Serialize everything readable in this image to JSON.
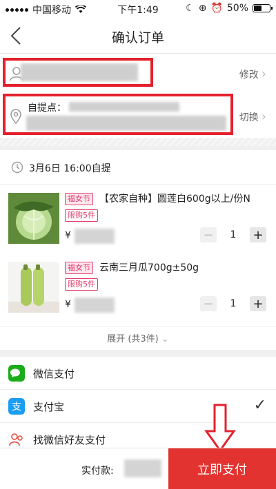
{
  "status_bar": {
    "carrier": "中国移动",
    "time": "下午1:49",
    "battery": "50%",
    "battery_level": 0.5
  },
  "nav": {
    "title": "确认订单",
    "back_icon": "chevron-left-icon"
  },
  "address": {
    "contact_action": "修改",
    "pickup_label": "自提点：",
    "pickup_action": "切换",
    "contact_icon": "person-icon",
    "pickup_icon": "location-pin-icon"
  },
  "order": {
    "delivery_time": "3月6日  16:00自提",
    "products": [
      {
        "festival_tag": "福女节",
        "name": "【农家自种】圆莲白600g以上/份N",
        "limit_tag": "限购5件",
        "price_symbol": "¥",
        "quantity": "1",
        "image": "cabbage-image"
      },
      {
        "festival_tag": "福女节",
        "name": "云南三月瓜700g±50g",
        "limit_tag": "限购5件",
        "price_symbol": "¥",
        "quantity": "1",
        "image": "zucchini-image"
      }
    ],
    "expand_label": "展开 (共3件)"
  },
  "payment": {
    "methods": [
      {
        "label": "微信支付",
        "icon": "wechat-pay-icon",
        "selected": false
      },
      {
        "label": "支付宝",
        "icon": "alipay-icon",
        "selected": true
      },
      {
        "label": "找微信好友支付",
        "icon": "friends-pay-icon",
        "selected": false
      }
    ],
    "check_mark": "✓"
  },
  "bottom": {
    "amount_label": "实付款:",
    "submit_label": "立即支付"
  },
  "colors": {
    "accent": "#e23330",
    "annotation": "#e4202c",
    "tag": "#e23d6b",
    "wechat": "#1aad19",
    "alipay": "#1a9ef4"
  }
}
